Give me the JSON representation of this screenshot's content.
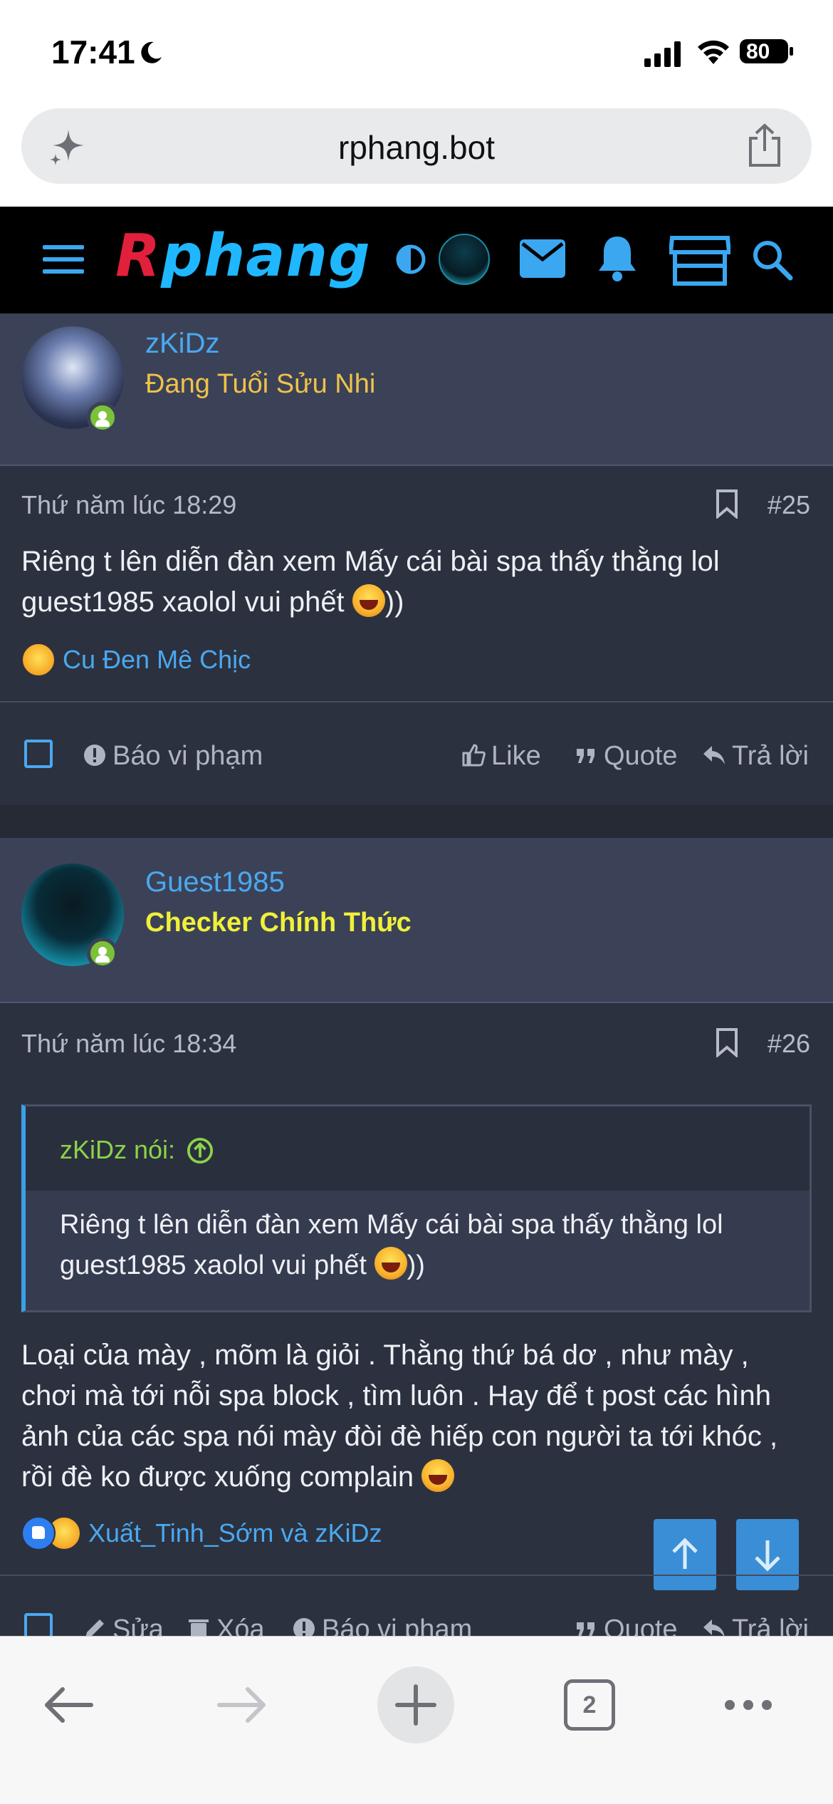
{
  "status_bar": {
    "time": "17:41",
    "battery": "80"
  },
  "browser": {
    "url": "rphang.bot",
    "tab_count": "2"
  },
  "site": {
    "logo_first": "R",
    "logo_rest": "phang"
  },
  "post1": {
    "username": "zKiDz",
    "user_title": "Đang Tuổi Sửu Nhi",
    "date": "Thứ năm lúc 18:29",
    "number": "#25",
    "text": "Riêng t lên diễn đàn xem Mấy cái bài spa thấy thằng lol guest1985 xaolol vui phết",
    "text_suffix": "))",
    "reactions": "Cu Đen Mê Chịc",
    "actions": {
      "report": "Báo vi phạm",
      "like": "Like",
      "quote": "Quote",
      "reply": "Trả lời"
    }
  },
  "post2": {
    "username": "Guest1985",
    "user_title": "Checker Chính Thức",
    "date": "Thứ năm lúc 18:34",
    "number": "#26",
    "quote_author": "zKiDz nói:",
    "quote_text": "Riêng t lên diễn đàn xem Mấy cái bài spa thấy thằng lol guest1985 xaolol vui phết",
    "quote_suffix": "))",
    "text": "Loại của mày , mõm là giỏi . Thằng thứ bá dơ , như mày , chơi mà tới nỗi spa block , tìm luôn . Hay để t post các hình ảnh của các spa nói mày đòi đè hiếp con người ta tới khóc , rồi đè ko được xuống complain",
    "reactions": "Xuất_Tinh_Sớm và zKiDz",
    "actions": {
      "edit": "Sửa",
      "delete": "Xóa",
      "report": "Báo vi phạm",
      "quote": "Quote",
      "reply": "Trả lời"
    }
  },
  "colors": {
    "accent": "#4aa8f0",
    "background": "#2c313f",
    "header_band": "#3b4257",
    "online": "#7cc13a"
  }
}
